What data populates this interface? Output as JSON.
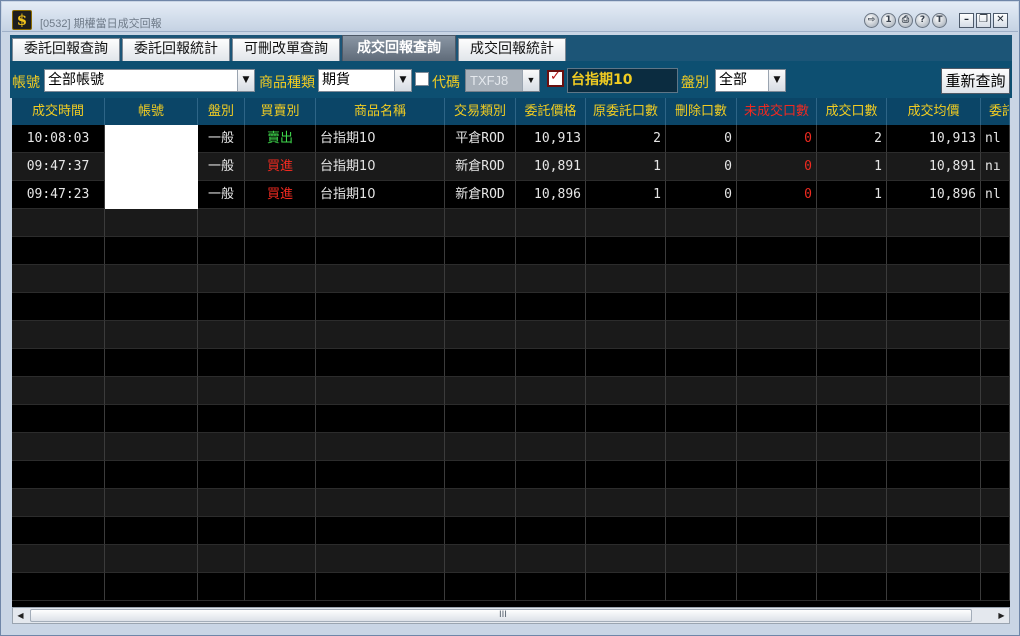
{
  "window": {
    "title": "[0532] 期權當日成交回報",
    "app_icon_glyph": "$",
    "title_buttons": [
      "exit-icon",
      "info-icon",
      "print-icon",
      "help-icon",
      "tool-icon"
    ],
    "title_button_glyphs": [
      "⇨",
      "1",
      "⎙",
      "?",
      "T"
    ],
    "window_controls": [
      "minimize-icon",
      "restore-icon",
      "close-icon"
    ],
    "window_control_glyphs": [
      "–",
      "❐",
      "✕"
    ]
  },
  "tabs": [
    {
      "label": "委託回報查詢",
      "active": false
    },
    {
      "label": "委託回報統計",
      "active": false
    },
    {
      "label": "可刪改單查詢",
      "active": false
    },
    {
      "label": "成交回報查詢",
      "active": true
    },
    {
      "label": "成交回報統計",
      "active": false
    }
  ],
  "filters": {
    "account_label": "帳號",
    "account_value": "全部帳號",
    "product_type_label": "商品種類",
    "product_type_value": "期貨",
    "code_label": "代碼",
    "code_checked": false,
    "code_value": "TXFJ8",
    "name_checked": true,
    "product_name": "台指期10",
    "position_label": "盤別",
    "position_value": "全部",
    "requery_button": "重新查詢"
  },
  "table": {
    "columns": [
      "成交時間",
      "帳號",
      "盤別",
      "買賣別",
      "商品名稱",
      "交易類別",
      "委託價格",
      "原委託口數",
      "刪除口數",
      "未成交口數",
      "成交口數",
      "成交均價",
      "委託"
    ],
    "rows": [
      {
        "time": "10:08:03",
        "account": "",
        "session": "一般",
        "side": "賣出",
        "product": "台指期10",
        "trade_type": "平倉ROD",
        "order_price": "10,913",
        "orig_qty": "2",
        "cancel_qty": "0",
        "unfilled_qty": "0",
        "filled_qty": "2",
        "avg_price": "10,913",
        "order_more": "nl"
      },
      {
        "time": "09:47:37",
        "account": "",
        "session": "一般",
        "side": "買進",
        "product": "台指期10",
        "trade_type": "新倉ROD",
        "order_price": "10,891",
        "orig_qty": "1",
        "cancel_qty": "0",
        "unfilled_qty": "0",
        "filled_qty": "1",
        "avg_price": "10,891",
        "order_more": "nı"
      },
      {
        "time": "09:47:23",
        "account": "",
        "session": "一般",
        "side": "買進",
        "product": "台指期10",
        "trade_type": "新倉ROD",
        "order_price": "10,896",
        "orig_qty": "1",
        "cancel_qty": "0",
        "unfilled_qty": "0",
        "filled_qty": "1",
        "avg_price": "10,896",
        "order_more": "nl"
      }
    ],
    "empty_rows": 14
  },
  "colors": {
    "header_text": "#f1cc22",
    "sell": "#3fd84c",
    "buy": "#f02a20",
    "unfilled": "#f02a20"
  },
  "scrollbar": {
    "grip": "III"
  }
}
